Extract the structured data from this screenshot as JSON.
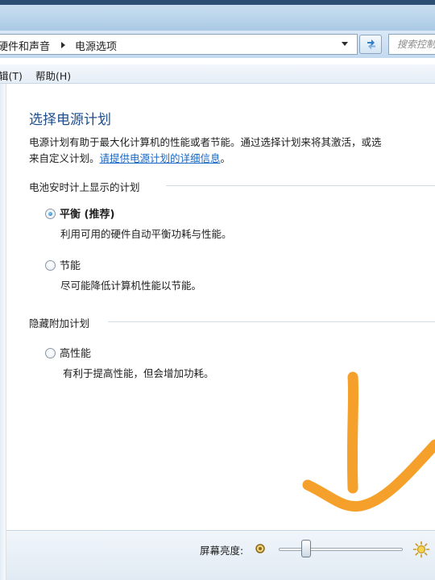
{
  "address": {
    "crumb_1": "硬件和声音",
    "crumb_2": "电源选项"
  },
  "search": {
    "placeholder": "搜索控制"
  },
  "menu": {
    "item_edit": "辑(T)",
    "item_help": "帮助(H)"
  },
  "main": {
    "title": "选择电源计划",
    "desc_line1": "电源计划有助于最大化计算机的性能或者节能。通过选择计划来将其激活，或选",
    "desc_line2_prefix": "来自定义计划。",
    "desc_link": "请提供电源计划的详细信息",
    "desc_line2_suffix": "。"
  },
  "battery_section": {
    "heading": "电池安时计上显示的计划",
    "plans": [
      {
        "name": "平衡 (推荐)",
        "description": "利用可用的硬件自动平衡功耗与性能。",
        "selected": true
      },
      {
        "name": "节能",
        "description": "尽可能降低计算机性能以节能。",
        "selected": false
      }
    ]
  },
  "hidden_section": {
    "heading": "隐藏附加计划",
    "plans": [
      {
        "name": "高性能",
        "description": "有利于提高性能，但会增加功耗。",
        "selected": false
      }
    ]
  },
  "brightness": {
    "label": "屏幕亮度:",
    "level_percent": 22
  },
  "colors": {
    "title_blue": "#1f4e8c",
    "link_blue": "#1668c7",
    "annotation_orange": "#f5a02a"
  },
  "icons": {
    "refresh": "refresh-icon",
    "dim": "brightness-low-icon",
    "bright": "brightness-high-icon"
  }
}
